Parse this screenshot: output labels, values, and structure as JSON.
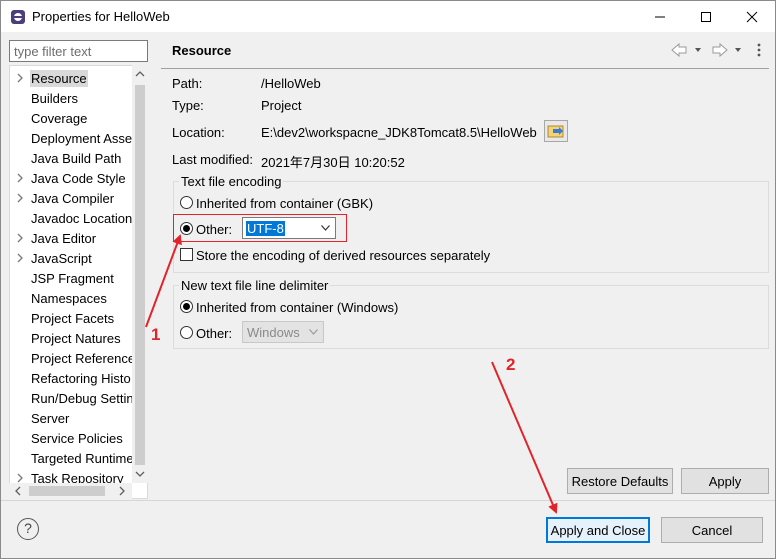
{
  "window": {
    "title": "Properties for HelloWeb",
    "controls": [
      "minimize-icon",
      "maximize-icon",
      "close-icon"
    ]
  },
  "filter": {
    "placeholder": "type filter text"
  },
  "tree": {
    "items": [
      {
        "label": "Resource",
        "expandable": true,
        "selected": true
      },
      {
        "label": "Builders",
        "expandable": false
      },
      {
        "label": "Coverage",
        "expandable": false
      },
      {
        "label": "Deployment Asse",
        "expandable": false
      },
      {
        "label": "Java Build Path",
        "expandable": false
      },
      {
        "label": "Java Code Style",
        "expandable": true
      },
      {
        "label": "Java Compiler",
        "expandable": true
      },
      {
        "label": "Javadoc Location",
        "expandable": false
      },
      {
        "label": "Java Editor",
        "expandable": true
      },
      {
        "label": "JavaScript",
        "expandable": true
      },
      {
        "label": "JSP Fragment",
        "expandable": false
      },
      {
        "label": "Namespaces",
        "expandable": false
      },
      {
        "label": "Project Facets",
        "expandable": false
      },
      {
        "label": "Project Natures",
        "expandable": false
      },
      {
        "label": "Project Reference",
        "expandable": false
      },
      {
        "label": "Refactoring Histo",
        "expandable": false
      },
      {
        "label": "Run/Debug Settin",
        "expandable": false
      },
      {
        "label": "Server",
        "expandable": false
      },
      {
        "label": "Service Policies",
        "expandable": false
      },
      {
        "label": "Targeted Runtime",
        "expandable": false
      },
      {
        "label": "Task Repository",
        "expandable": true
      }
    ]
  },
  "page": {
    "title": "Resource",
    "path_label": "Path:",
    "path_value": "/HelloWeb",
    "type_label": "Type:",
    "type_value": "Project",
    "location_label": "Location:",
    "location_value": "E:\\dev2\\workspacne_JDK8Tomcat8.5\\HelloWeb",
    "modified_label": "Last modified:",
    "modified_value": "2021年7月30日 10:20:52"
  },
  "encoding": {
    "group_title": "Text file encoding",
    "inherited_label": "Inherited from container (GBK)",
    "other_label": "Other:",
    "other_value": "UTF-8",
    "separate_label": "Store the encoding of derived resources separately",
    "selected": "other"
  },
  "delimiter": {
    "group_title": "New text file line delimiter",
    "inherited_label": "Inherited from container (Windows)",
    "other_label": "Other:",
    "other_value": "Windows",
    "selected": "inherited"
  },
  "buttons": {
    "restore_defaults": "Restore Defaults",
    "apply": "Apply",
    "apply_close": "Apply and Close",
    "cancel": "Cancel"
  },
  "annotations": {
    "one": "1",
    "two": "2",
    "color": "#e0242a"
  }
}
